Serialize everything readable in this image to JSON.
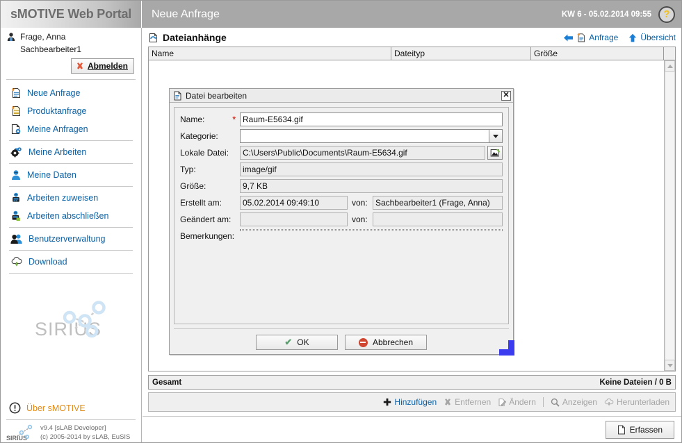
{
  "header": {
    "brand": "sMOTIVE Web Portal",
    "page_title": "Neue Anfrage",
    "kw_datetime": "KW 6 - 05.02.2014 09:55",
    "help_icon": "help-circle-icon",
    "help_glyph": "?"
  },
  "sidebar": {
    "user_name": "Frage, Anna",
    "user_role": "Sachbearbeiter1",
    "logout_label": "Abmelden",
    "nav": [
      {
        "label": "Neue Anfrage",
        "icon": "new-request-icon"
      },
      {
        "label": "Produktanfrage",
        "icon": "product-request-icon"
      },
      {
        "label": "Meine Anfragen",
        "icon": "my-requests-icon"
      },
      {
        "label": "Meine Arbeiten",
        "icon": "gear-icon"
      },
      {
        "label": "Meine Daten",
        "icon": "user-data-icon"
      },
      {
        "label": "Arbeiten zuweisen",
        "icon": "assign-work-icon"
      },
      {
        "label": "Arbeiten abschließen",
        "icon": "complete-work-icon"
      },
      {
        "label": "Benutzerverwaltung",
        "icon": "users-icon"
      },
      {
        "label": "Download",
        "icon": "cloud-download-icon"
      }
    ],
    "logo_text": "SIRIUS",
    "about_label": "Über sMOTIVE",
    "about_icon": "info-circle-icon",
    "version_line1": "v9.4 [sLAB Developer]",
    "version_line2": "(c) 2005-2014 by sLAB, EuSIS",
    "footer_logo": "SIRIUS"
  },
  "main": {
    "section_title": "Dateianhänge",
    "section_icon": "attachments-icon",
    "links": [
      {
        "label": "Anfrage",
        "icon": "back-arrow-icon"
      },
      {
        "label": "Übersicht",
        "icon": "up-arrow-icon"
      }
    ],
    "table": {
      "columns": [
        "Name",
        "Dateityp",
        "Größe"
      ],
      "rows": []
    },
    "totals_label": "Gesamt",
    "totals_value": "Keine Dateien / 0 B",
    "actions": [
      {
        "label": "Hinzufügen",
        "icon": "plus-icon",
        "enabled": true
      },
      {
        "label": "Entfernen",
        "icon": "remove-x-icon",
        "enabled": false
      },
      {
        "label": "Ändern",
        "icon": "edit-pencil-icon",
        "enabled": false
      },
      {
        "label": "Anzeigen",
        "icon": "magnifier-icon",
        "enabled": false
      },
      {
        "label": "Herunterladen",
        "icon": "download-icon",
        "enabled": false
      }
    ],
    "submit_label": "Erfassen",
    "submit_icon": "document-icon"
  },
  "dialog": {
    "title": "Datei bearbeiten",
    "title_icon": "file-icon",
    "close_glyph": "✕",
    "fields": {
      "name_label": "Name:",
      "name_required": "*",
      "name_value": "Raum-E5634.gif",
      "kategorie_label": "Kategorie:",
      "kategorie_value": "",
      "lokale_datei_label": "Lokale Datei:",
      "lokale_datei_value": "C:\\Users\\Public\\Documents\\Raum-E5634.gif",
      "browse_icon": "browse-folder-icon",
      "typ_label": "Typ:",
      "typ_value": "image/gif",
      "groesse_label": "Größe:",
      "groesse_value": "9,7 KB",
      "erstellt_label": "Erstellt am:",
      "erstellt_value": "05.02.2014 09:49:10",
      "erstellt_von_label": "von:",
      "erstellt_von_value": "Sachbearbeiter1 (Frage, Anna)",
      "geaendert_label": "Geändert am:",
      "geaendert_value": "",
      "geaendert_von_label": "von:",
      "geaendert_von_value": "",
      "bemerkungen_label": "Bemerkungen:",
      "bemerkungen_value": ""
    },
    "ok_label": "OK",
    "cancel_label": "Abbrechen"
  },
  "colors": {
    "link_blue": "#0b61a4",
    "accent_orange": "#e08a14",
    "header_gray": "#a8a8a8",
    "required_red": "#d43a2a",
    "resize_blue": "#3b3bf0"
  }
}
